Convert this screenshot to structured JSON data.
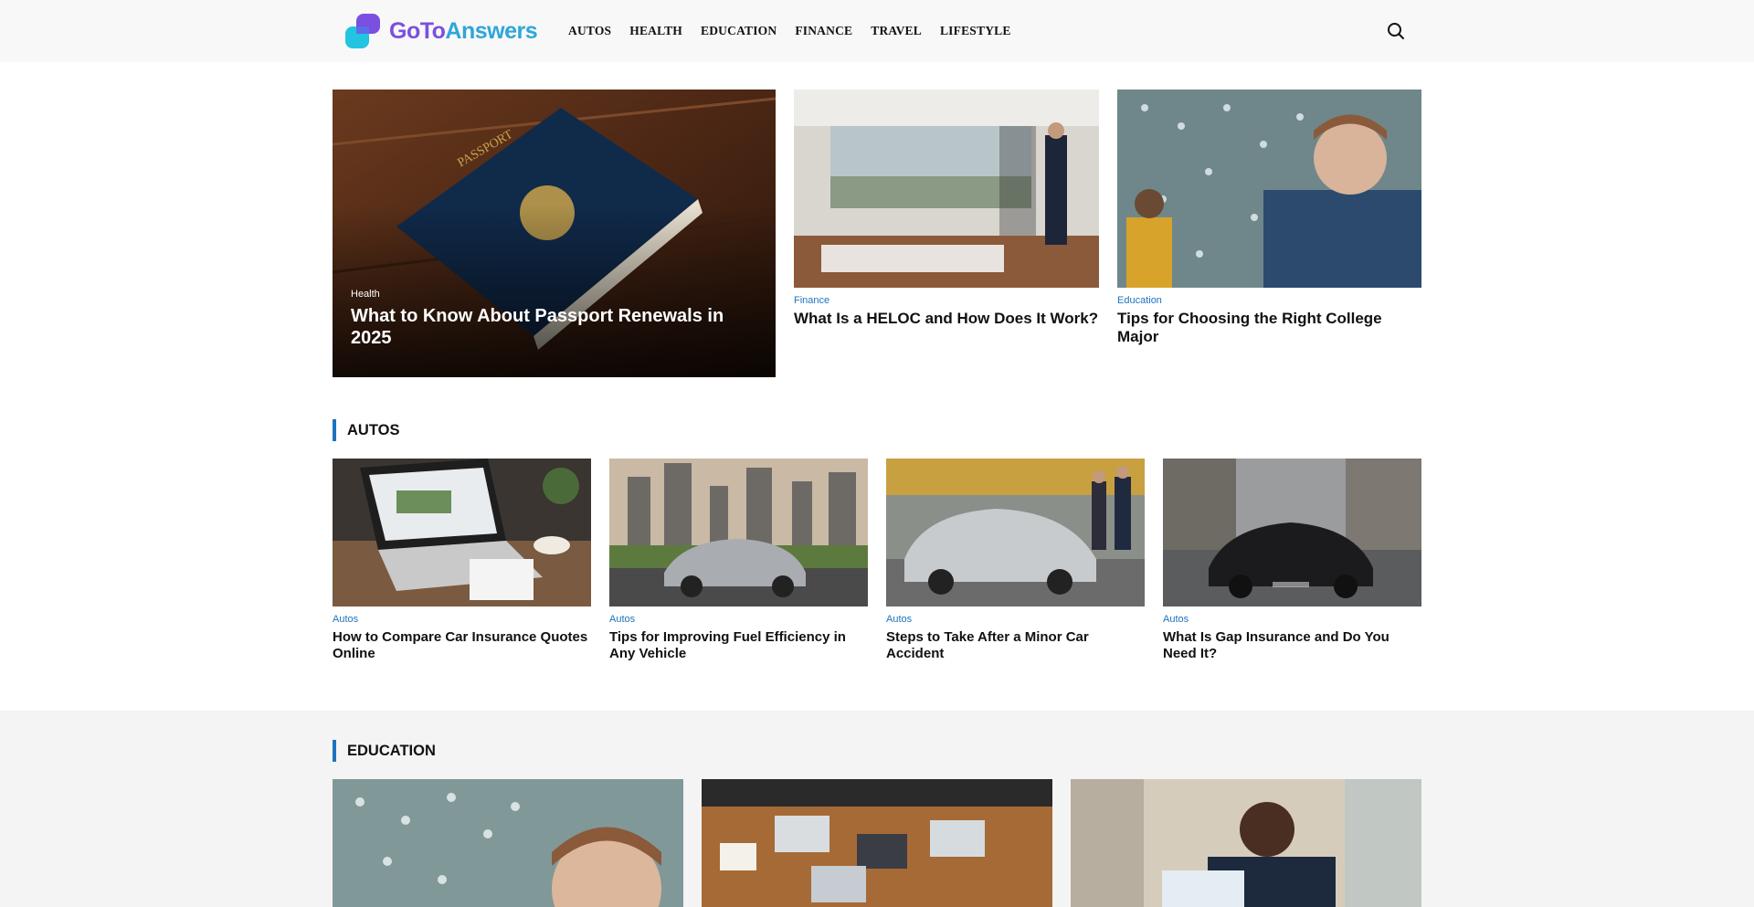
{
  "brand": {
    "name_part1": "GoTo",
    "name_part2": "Answers"
  },
  "nav": {
    "items": [
      "AUTOS",
      "HEALTH",
      "EDUCATION",
      "FINANCE",
      "TRAVEL",
      "LIFESTYLE"
    ]
  },
  "icons": {
    "search": "search-icon"
  },
  "colors": {
    "accent": "#1e73be",
    "logo_purple": "#7b4fe0",
    "logo_cyan": "#2fa6d8"
  },
  "featured": {
    "hero": {
      "category": "Health",
      "title": "What to Know About Passport Renewals in 2025"
    },
    "side": [
      {
        "category": "Finance",
        "title": "What Is a HELOC and How Does It Work?"
      },
      {
        "category": "Education",
        "title": "Tips for Choosing the Right College Major"
      }
    ]
  },
  "autos": {
    "heading": "AUTOS",
    "posts": [
      {
        "category": "Autos",
        "title": "How to Compare Car Insurance Quotes Online"
      },
      {
        "category": "Autos",
        "title": "Tips for Improving Fuel Efficiency in Any Vehicle"
      },
      {
        "category": "Autos",
        "title": "Steps to Take After a Minor Car Accident"
      },
      {
        "category": "Autos",
        "title": "What Is Gap Insurance and Do You Need It?"
      }
    ]
  },
  "education": {
    "heading": "EDUCATION"
  }
}
